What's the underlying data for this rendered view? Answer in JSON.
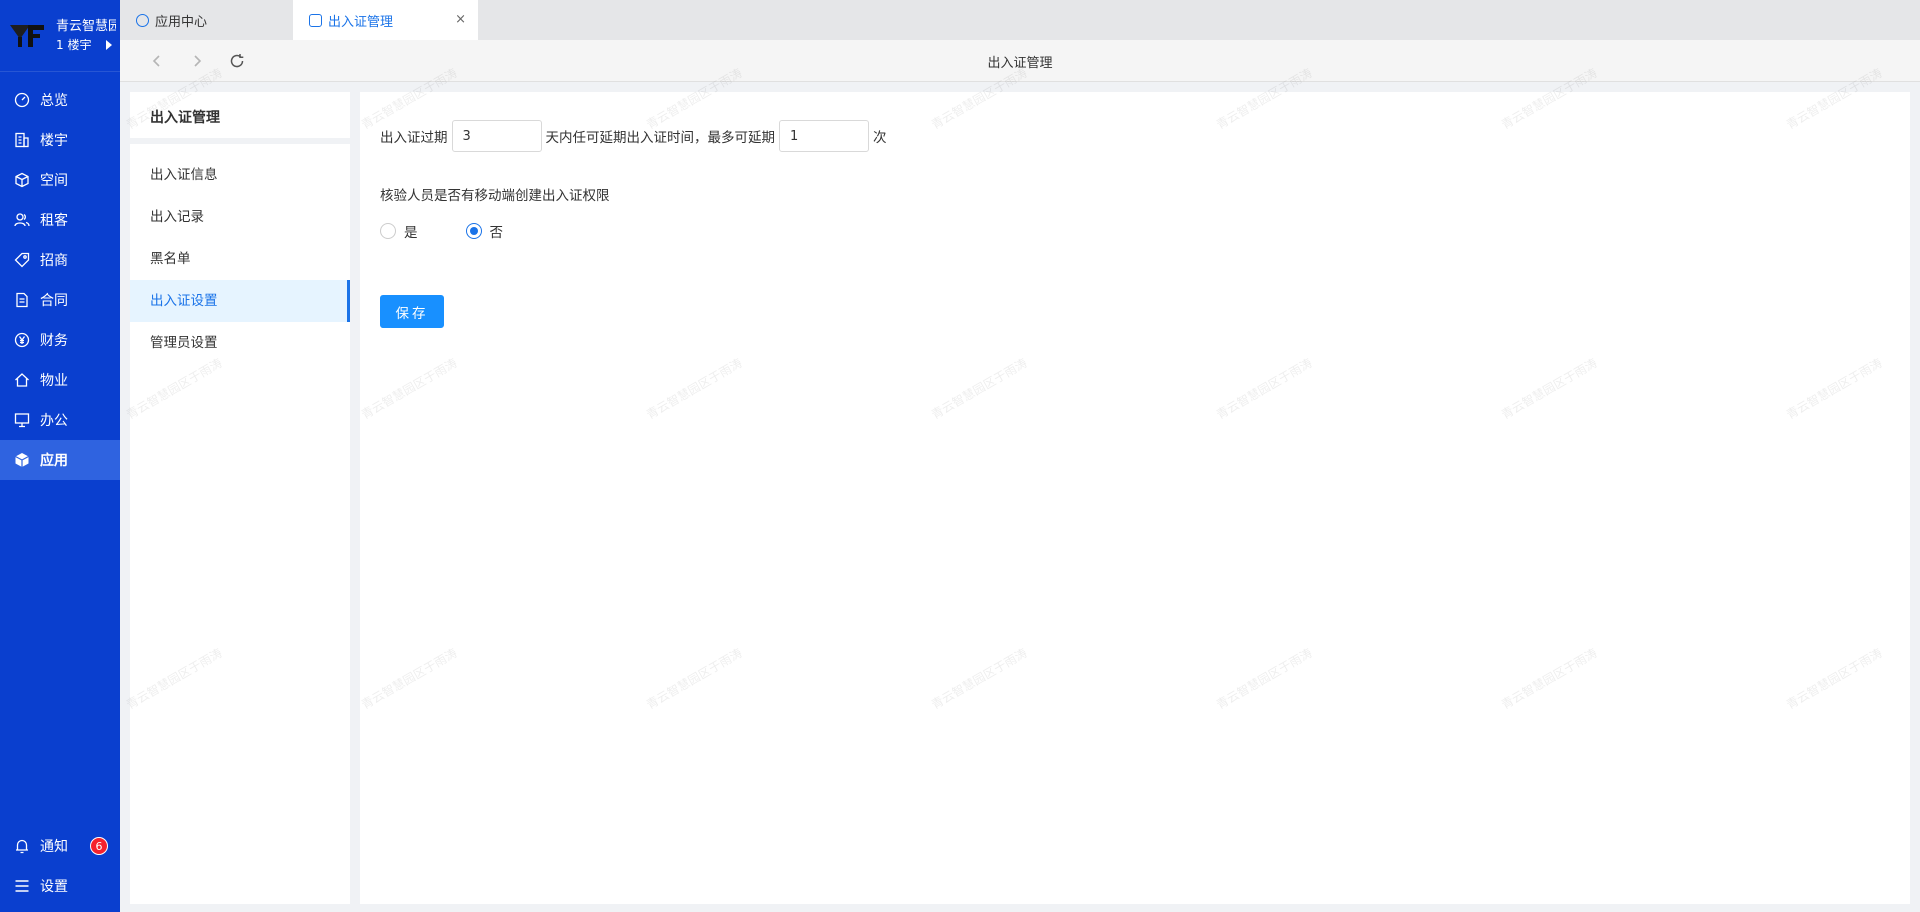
{
  "brand": {
    "name": "青云智慧园区",
    "building": "1 楼宇"
  },
  "nav": {
    "items": [
      {
        "label": "总览",
        "icon": "dashboard-icon"
      },
      {
        "label": "楼宇",
        "icon": "building-icon"
      },
      {
        "label": "空间",
        "icon": "cube-icon"
      },
      {
        "label": "租客",
        "icon": "users-icon"
      },
      {
        "label": "招商",
        "icon": "tag-icon"
      },
      {
        "label": "合同",
        "icon": "document-icon"
      },
      {
        "label": "财务",
        "icon": "yen-icon"
      },
      {
        "label": "物业",
        "icon": "home-icon"
      },
      {
        "label": "办公",
        "icon": "monitor-icon"
      },
      {
        "label": "应用",
        "icon": "app-cube-icon",
        "active": true
      }
    ],
    "bottom": {
      "notify_label": "通知",
      "notify_count": "6",
      "settings_label": "设置"
    }
  },
  "tabs": [
    {
      "label": "应用中心"
    },
    {
      "label": "出入证管理",
      "active": true,
      "close": "×"
    }
  ],
  "toolbar": {
    "title": "出入证管理"
  },
  "watermark": "青云智慧园区于雨涛",
  "submenu": {
    "title": "出入证管理",
    "items": [
      "出入证信息",
      "出入记录",
      "黑名单",
      "出入证设置",
      "管理员设置"
    ],
    "active_index": 3
  },
  "form": {
    "expire_prefix": "出入证过期",
    "expire_days": "3",
    "expire_middle": "天内任可延期出入证时间，最多可延期",
    "max_extend": "1",
    "expire_suffix": "次",
    "question": "核验人员是否有移动端创建出入证权限",
    "option_yes": "是",
    "option_no": "否",
    "selected": "否",
    "save_label": "保存"
  },
  "colors": {
    "sidebar": "#0a3fcf",
    "accent": "#1890ff",
    "badge": "#f5222d"
  }
}
